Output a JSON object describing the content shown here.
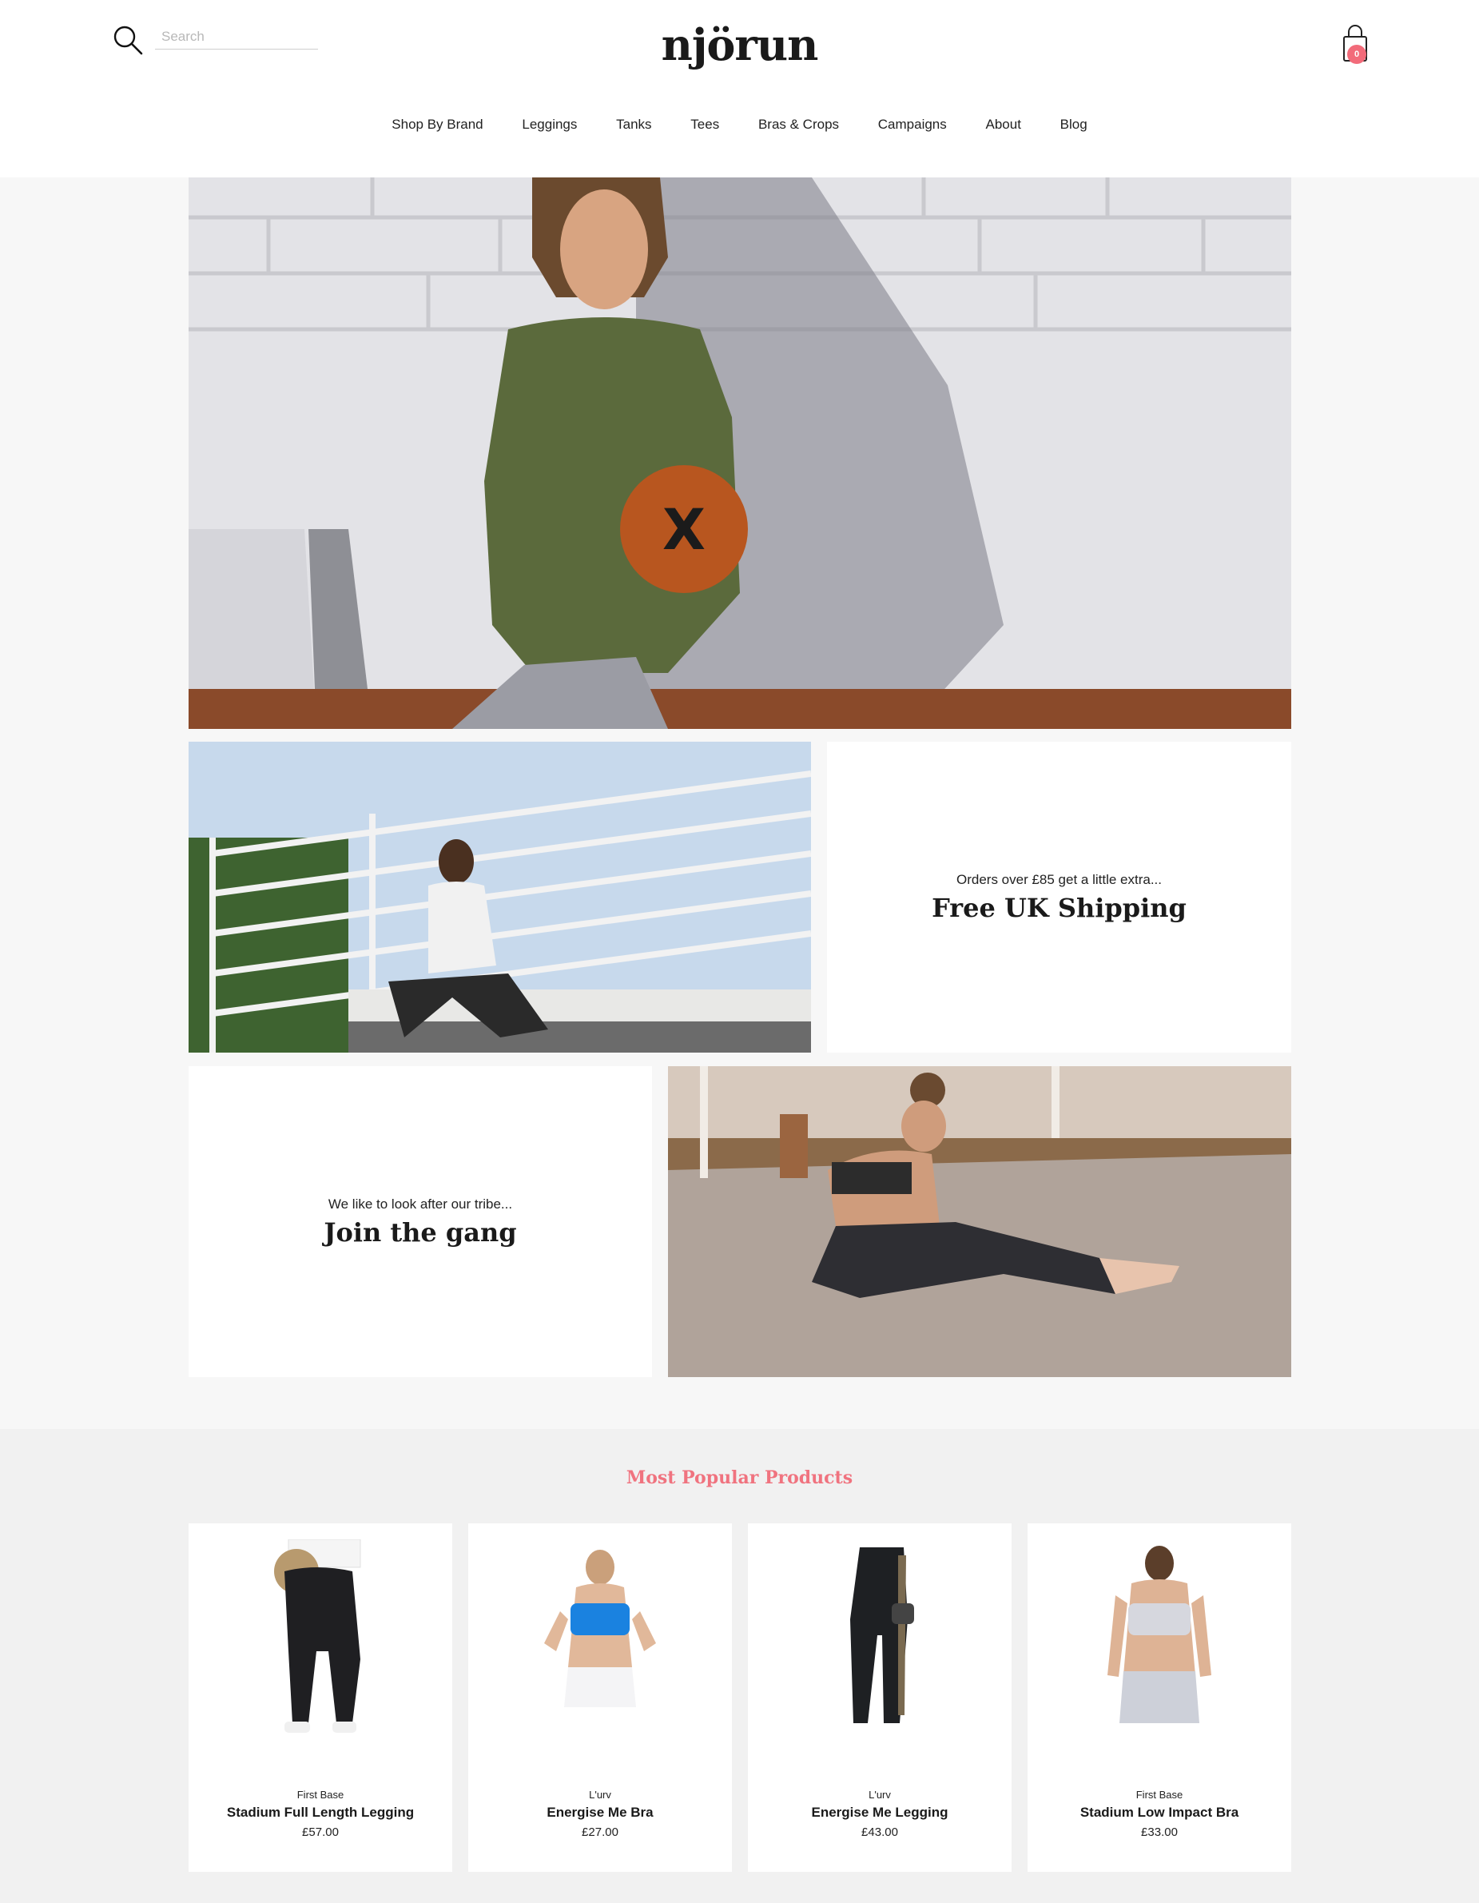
{
  "header": {
    "search_placeholder": "Search",
    "logo": "njörun",
    "cart_count": "0",
    "colors": {
      "cart_badge": "#f26b7a",
      "accent": "#f0737f"
    }
  },
  "nav": [
    "Shop By Brand",
    "Leggings",
    "Tanks",
    "Tees",
    "Bras & Crops",
    "Campaigns",
    "About",
    "Blog"
  ],
  "promos": {
    "shipping": {
      "subtitle": "Orders over £85 get a little extra...",
      "title": "Free UK Shipping"
    },
    "gang": {
      "subtitle": "We like to look after our tribe...",
      "title": "Join the gang"
    }
  },
  "popular": {
    "title": "Most Popular Products",
    "products": [
      {
        "brand": "First Base",
        "name": "Stadium Full Length Legging",
        "price": "£57.00"
      },
      {
        "brand": "L'urv",
        "name": "Energise Me Bra",
        "price": "£27.00"
      },
      {
        "brand": "L'urv",
        "name": "Energise Me Legging",
        "price": "£43.00"
      },
      {
        "brand": "First Base",
        "name": "Stadium Low Impact Bra",
        "price": "£33.00"
      }
    ]
  }
}
